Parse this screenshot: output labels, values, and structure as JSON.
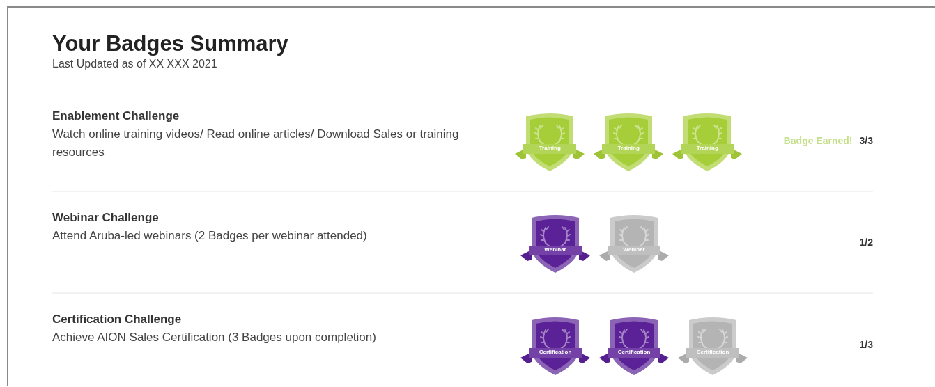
{
  "title": "Your Badges Summary",
  "subtitle": "Last Updated as of XX XXX 2021",
  "challenges": [
    {
      "name": "Enablement Challenge",
      "description": "Watch online training videos/ Read online articles/ Download Sales or training resources",
      "color": "#a6ce39",
      "badges": [
        {
          "label": "Training",
          "earned": true
        },
        {
          "label": "Training",
          "earned": true
        },
        {
          "label": "Training",
          "earned": true
        }
      ],
      "status": "Badge Earned!",
      "progress": "3/3"
    },
    {
      "name": "Webinar Challenge",
      "description": "Attend Aruba-led webinars (2 Badges per webinar attended)",
      "color": "#5b2196",
      "badges": [
        {
          "label": "Webinar",
          "earned": true
        },
        {
          "label": "Webinar",
          "earned": false
        }
      ],
      "progress": "1/2"
    },
    {
      "name": "Certification Challenge",
      "description": "Achieve AION Sales Certification (3 Badges upon completion)",
      "color": "#5b2196",
      "badges": [
        {
          "label": "Certification",
          "earned": true
        },
        {
          "label": "Certification",
          "earned": true
        },
        {
          "label": "Certification",
          "earned": false
        }
      ],
      "progress": "1/3"
    }
  ]
}
